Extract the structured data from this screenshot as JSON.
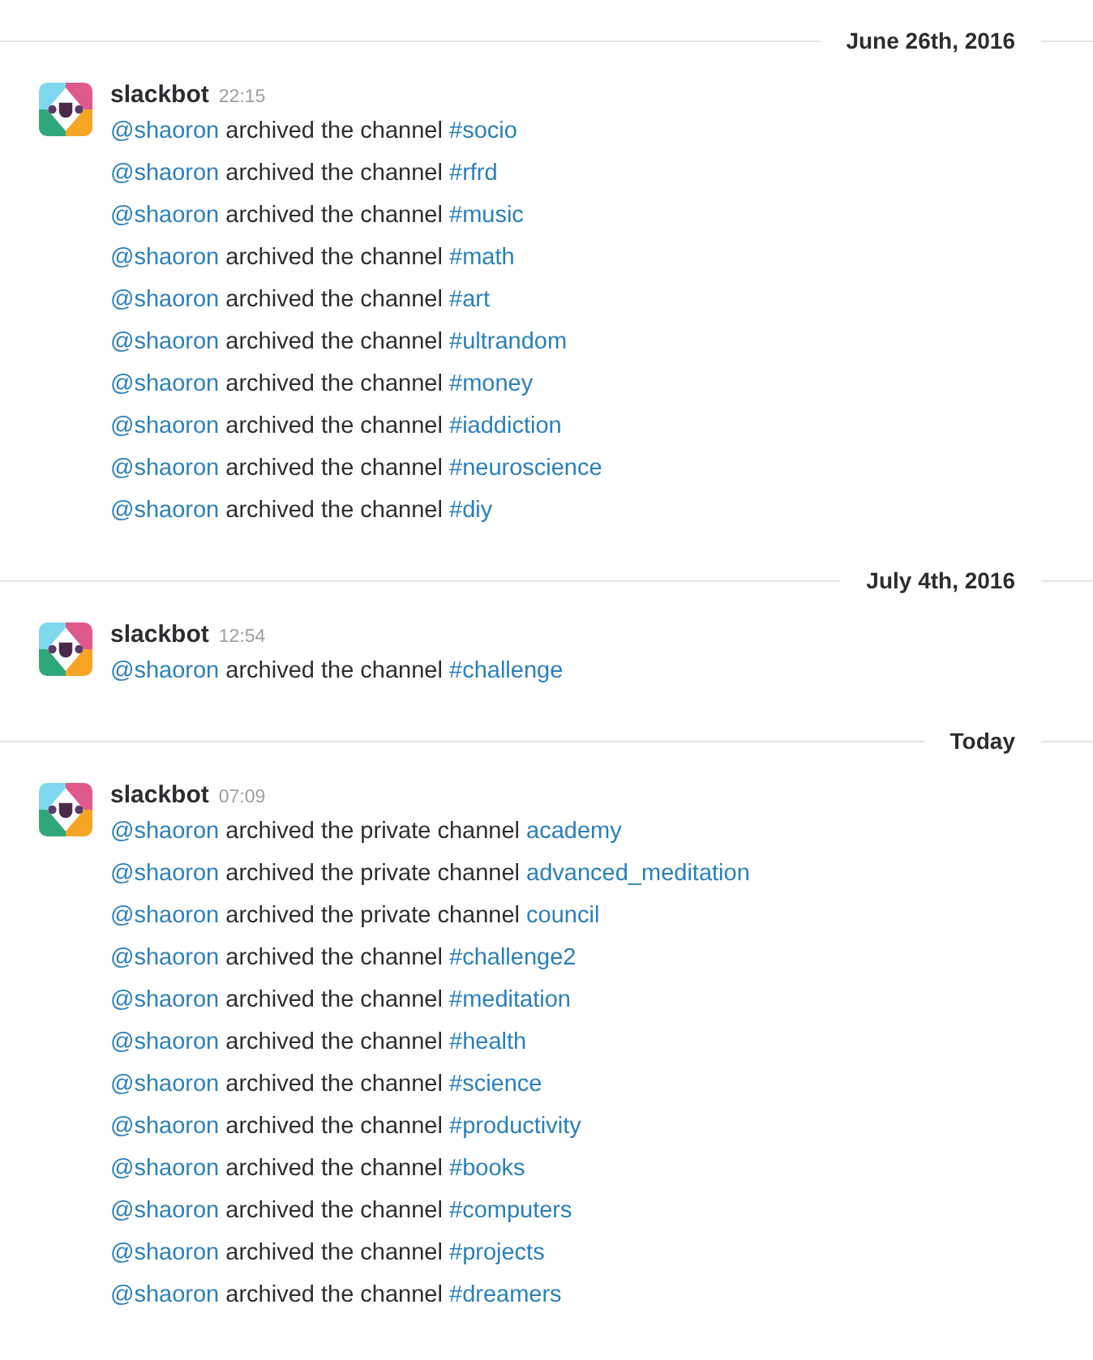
{
  "days": [
    {
      "date": "June 26th, 2016",
      "messages": [
        {
          "author": "slackbot",
          "time": "22:15",
          "lines": [
            {
              "mention": "@shaoron",
              "action": "archived the channel",
              "channel": "#socio"
            },
            {
              "mention": "@shaoron",
              "action": "archived the channel",
              "channel": "#rfrd"
            },
            {
              "mention": "@shaoron",
              "action": "archived the channel",
              "channel": "#music"
            },
            {
              "mention": "@shaoron",
              "action": "archived the channel",
              "channel": "#math"
            },
            {
              "mention": "@shaoron",
              "action": "archived the channel",
              "channel": "#art"
            },
            {
              "mention": "@shaoron",
              "action": "archived the channel",
              "channel": "#ultrandom"
            },
            {
              "mention": "@shaoron",
              "action": "archived the channel",
              "channel": "#money"
            },
            {
              "mention": "@shaoron",
              "action": "archived the channel",
              "channel": "#iaddiction"
            },
            {
              "mention": "@shaoron",
              "action": "archived the channel",
              "channel": "#neuroscience"
            },
            {
              "mention": "@shaoron",
              "action": "archived the channel",
              "channel": "#diy"
            }
          ]
        }
      ]
    },
    {
      "date": "July 4th, 2016",
      "messages": [
        {
          "author": "slackbot",
          "time": "12:54",
          "lines": [
            {
              "mention": "@shaoron",
              "action": "archived the channel",
              "channel": "#challenge"
            }
          ]
        }
      ]
    },
    {
      "date": "Today",
      "messages": [
        {
          "author": "slackbot",
          "time": "07:09",
          "lines": [
            {
              "mention": "@shaoron",
              "action": "archived the private channel",
              "channel": "academy"
            },
            {
              "mention": "@shaoron",
              "action": "archived the private channel",
              "channel": "advanced_meditation"
            },
            {
              "mention": "@shaoron",
              "action": "archived the private channel",
              "channel": "council"
            },
            {
              "mention": "@shaoron",
              "action": "archived the channel",
              "channel": "#challenge2"
            },
            {
              "mention": "@shaoron",
              "action": "archived the channel",
              "channel": "#meditation"
            },
            {
              "mention": "@shaoron",
              "action": "archived the channel",
              "channel": "#health"
            },
            {
              "mention": "@shaoron",
              "action": "archived the channel",
              "channel": "#science"
            },
            {
              "mention": "@shaoron",
              "action": "archived the channel",
              "channel": "#productivity"
            },
            {
              "mention": "@shaoron",
              "action": "archived the channel",
              "channel": "#books"
            },
            {
              "mention": "@shaoron",
              "action": "archived the channel",
              "channel": "#computers"
            },
            {
              "mention": "@shaoron",
              "action": "archived the channel",
              "channel": "#projects"
            },
            {
              "mention": "@shaoron",
              "action": "archived the channel",
              "channel": "#dreamers"
            }
          ]
        }
      ]
    }
  ]
}
